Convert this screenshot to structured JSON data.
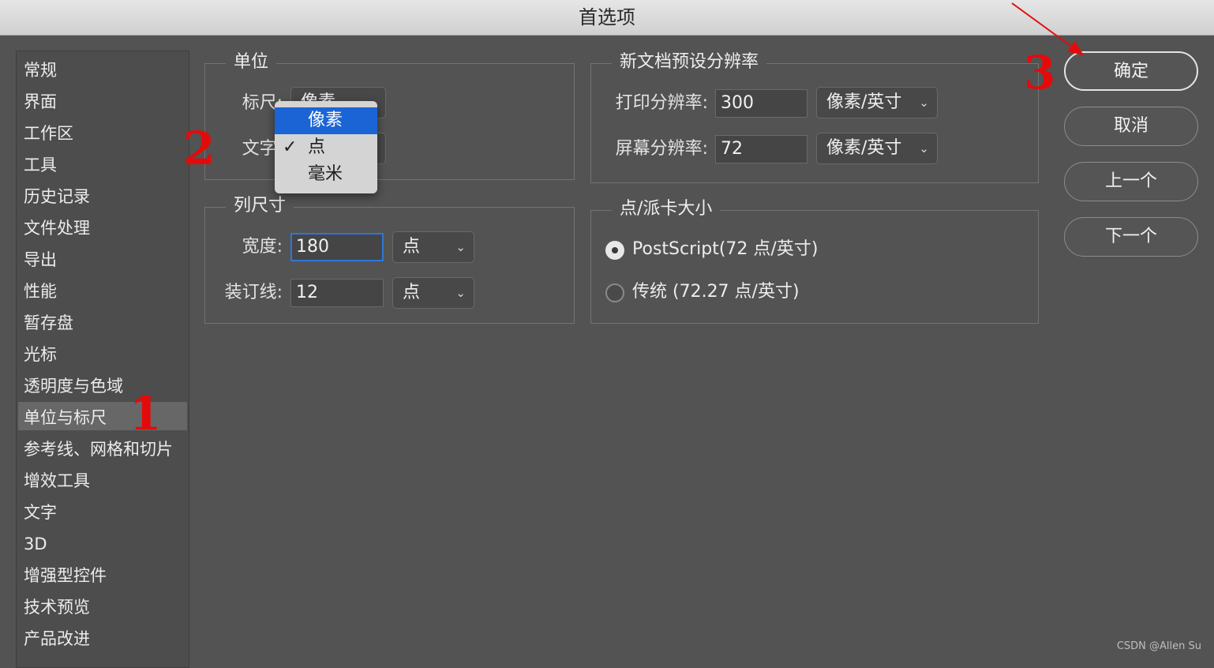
{
  "window": {
    "title": "首选项"
  },
  "sidebar": {
    "items": [
      {
        "label": "常规"
      },
      {
        "label": "界面"
      },
      {
        "label": "工作区"
      },
      {
        "label": "工具"
      },
      {
        "label": "历史记录"
      },
      {
        "label": "文件处理"
      },
      {
        "label": "导出"
      },
      {
        "label": "性能"
      },
      {
        "label": "暂存盘"
      },
      {
        "label": "光标"
      },
      {
        "label": "透明度与色域"
      },
      {
        "label": "单位与标尺",
        "selected": true
      },
      {
        "label": "参考线、网格和切片"
      },
      {
        "label": "增效工具"
      },
      {
        "label": "文字"
      },
      {
        "label": "3D"
      },
      {
        "label": "增强型控件"
      },
      {
        "label": "技术预览"
      },
      {
        "label": "产品改进"
      }
    ]
  },
  "units": {
    "legend": "单位",
    "ruler_label": "标尺:",
    "ruler_value": "像素",
    "type_label": "文字:",
    "type_value": "点"
  },
  "dropdown": {
    "options": [
      {
        "label": "像素",
        "highlighted": true
      },
      {
        "label": "点",
        "checked": true
      },
      {
        "label": "毫米"
      }
    ]
  },
  "column_size": {
    "legend": "列尺寸",
    "width_label": "宽度:",
    "width_value": "180",
    "width_unit": "点",
    "gutter_label": "装订线:",
    "gutter_value": "12",
    "gutter_unit": "点"
  },
  "resolution": {
    "legend": "新文档预设分辨率",
    "print_label": "打印分辨率:",
    "print_value": "300",
    "print_unit": "像素/英寸",
    "screen_label": "屏幕分辨率:",
    "screen_value": "72",
    "screen_unit": "像素/英寸"
  },
  "point_size": {
    "legend": "点/派卡大小",
    "postscript_label": "PostScript(72 点/英寸)",
    "traditional_label": "传统 (72.27 点/英寸)",
    "selected": "postscript"
  },
  "buttons": {
    "ok": "确定",
    "cancel": "取消",
    "prev": "上一个",
    "next": "下一个"
  },
  "annotations": {
    "n1": "1",
    "n2": "2",
    "n3": "3"
  },
  "colors": {
    "annotation": "#e50a0a",
    "highlight": "#1b64d6",
    "panel": "#535353"
  },
  "watermark": "CSDN @Allen Su"
}
